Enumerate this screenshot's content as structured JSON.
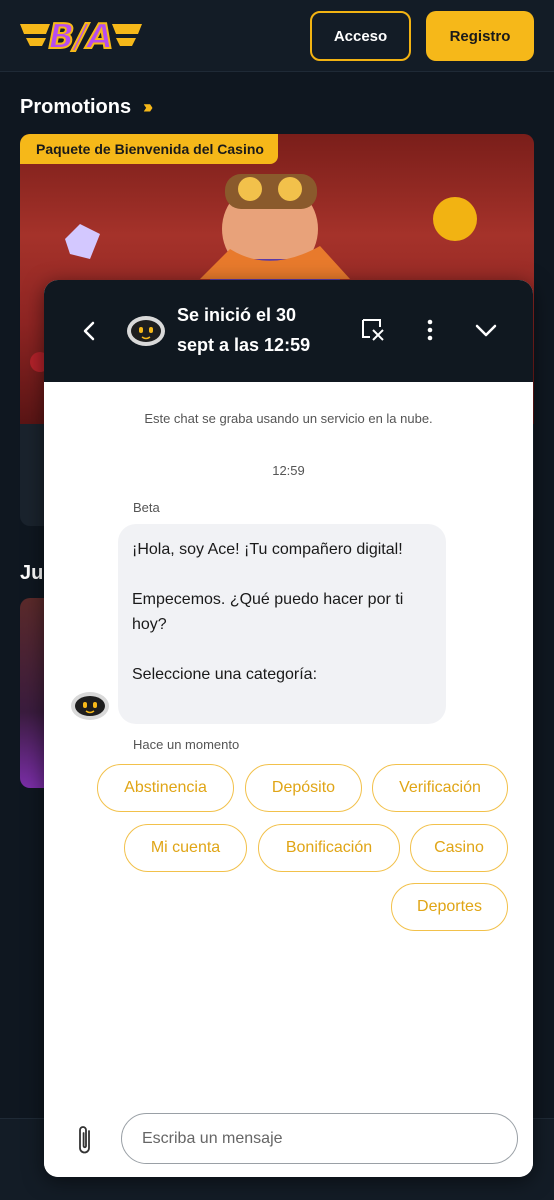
{
  "header": {
    "logo_text": "B/A",
    "login_label": "Acceso",
    "register_label": "Registro"
  },
  "promotions": {
    "title": "Promotions",
    "badge": "Paquete de Bienvenida del Casino"
  },
  "games_section": {
    "title_partial": "Ju"
  },
  "chat": {
    "header_title": "Se inició el 30 sept a las 12:59",
    "recording_notice": "Este chat se graba usando un servicio en la nube.",
    "time": "12:59",
    "sender": "Beta",
    "message_lines": [
      "¡Hola, soy Ace! ¡Tu compañero digital!",
      "Empecemos. ¿Qué puedo hacer por ti hoy?",
      "Seleccione una categoría:"
    ],
    "message_time": "Hace un momento",
    "categories": [
      "Abstinencia",
      "Depósito",
      "Verificación",
      "Mi cuenta",
      "Bonificación",
      "Casino",
      "Deportes"
    ],
    "input_placeholder": "Escriba un mensaje"
  },
  "colors": {
    "accent": "#f6b819",
    "chip_border": "#f2c14b",
    "chip_text": "#e0a516",
    "header_bg": "#101820",
    "page_bg": "#0f1720"
  }
}
